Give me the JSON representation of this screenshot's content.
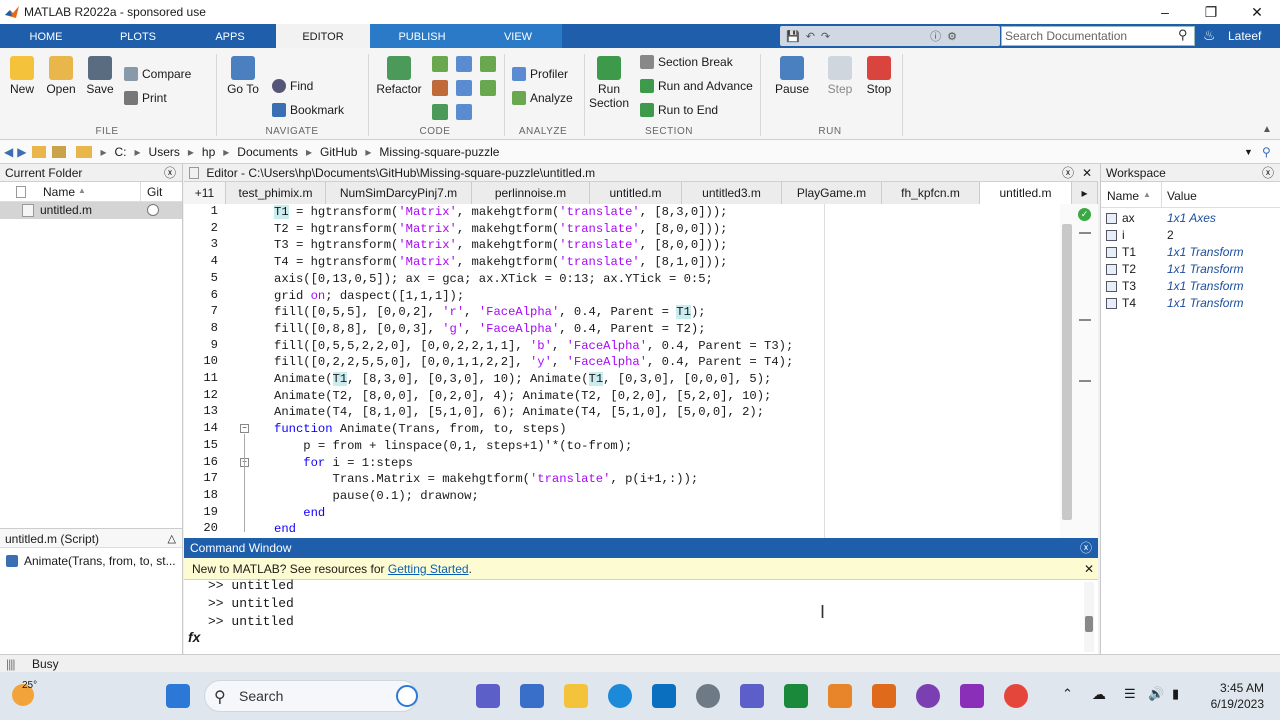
{
  "window": {
    "title": "MATLAB R2022a - sponsored use"
  },
  "tabs": [
    "HOME",
    "PLOTS",
    "APPS",
    "EDITOR",
    "PUBLISH",
    "VIEW"
  ],
  "search": {
    "placeholder": "Search Documentation"
  },
  "user": {
    "name": "Lateef"
  },
  "ribbon": {
    "new": "New",
    "open": "Open",
    "save": "Save",
    "compare": "Compare",
    "print": "Print",
    "goto": "Go To",
    "find": "Find",
    "bookmark": "Bookmark",
    "refactor": "Refactor",
    "profiler": "Profiler",
    "analyze": "Analyze",
    "run_section_1": "Run",
    "run_section_2": "Section",
    "section_break": "Section Break",
    "run_advance": "Run and Advance",
    "run_end": "Run to End",
    "pause": "Pause",
    "step": "Step",
    "stop": "Stop",
    "groups": {
      "file": "FILE",
      "navigate": "NAVIGATE",
      "code": "CODE",
      "analyze": "ANALYZE",
      "section": "SECTION",
      "run": "RUN"
    }
  },
  "address": {
    "crumbs": [
      "C:",
      "Users",
      "hp",
      "Documents",
      "GitHub",
      "Missing-square-puzzle"
    ]
  },
  "folder": {
    "title": "Current Folder",
    "col_name": "Name",
    "col_git": "Git",
    "files": [
      {
        "name": "untitled.m"
      }
    ],
    "details_title": "untitled.m  (Script)",
    "details_item": "Animate(Trans, from, to, st..."
  },
  "editor": {
    "title": "Editor - C:\\Users\\hp\\Documents\\GitHub\\Missing-square-puzzle\\untitled.m",
    "overflow": "+11",
    "tabs": [
      "test_phimix.m",
      "NumSimDarcyPinj7.m",
      "perlinnoise.m",
      "untitled.m",
      "untitled3.m",
      "PlayGame.m",
      "fh_kpfcn.m",
      "untitled.m"
    ],
    "line_numbers": [
      "1",
      "2",
      "3",
      "4",
      "5",
      "6",
      "7",
      "8",
      "9",
      "10",
      "11",
      "12",
      "13",
      "14",
      "15",
      "16",
      "17",
      "18",
      "19",
      "20"
    ]
  },
  "command": {
    "title": "Command Window",
    "banner_text": "New to MATLAB? See resources for ",
    "banner_link": "Getting Started",
    "banner_end": ".",
    "lines": [
      ">> untitled",
      ">> untitled",
      ">> untitled"
    ],
    "prompt": "fx"
  },
  "workspace": {
    "title": "Workspace",
    "col_name": "Name",
    "col_value": "Value",
    "vars": [
      {
        "name": "ax",
        "value": "1x1 Axes"
      },
      {
        "name": "i",
        "value": "2"
      },
      {
        "name": "T1",
        "value": "1x1 Transform"
      },
      {
        "name": "T2",
        "value": "1x1 Transform"
      },
      {
        "name": "T3",
        "value": "1x1 Transform"
      },
      {
        "name": "T4",
        "value": "1x1 Transform"
      }
    ]
  },
  "status": {
    "text": "Busy"
  },
  "taskbar": {
    "search": "Search",
    "time": "3:45 AM",
    "date": "6/19/2023",
    "weather": "25°"
  }
}
